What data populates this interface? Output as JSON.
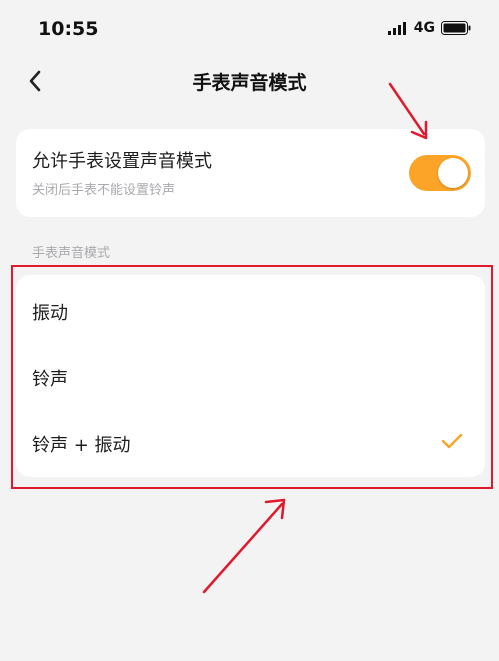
{
  "status_bar": {
    "time": "10:55",
    "network": "4G",
    "icons": [
      "signal-icon",
      "battery-icon"
    ]
  },
  "nav": {
    "back_icon": "chevron-left-icon",
    "title": "手表声音模式"
  },
  "permission": {
    "title": "允许手表设置声音模式",
    "subtitle": "关闭后手表不能设置铃声",
    "toggle_on": true,
    "toggle_color": "#fba428"
  },
  "section": {
    "label": "手表声音模式"
  },
  "options": [
    {
      "label": "振动",
      "selected": false
    },
    {
      "label": "铃声",
      "selected": false
    },
    {
      "label": "铃声 + 振动",
      "selected": true
    }
  ],
  "colors": {
    "accent": "#fba428",
    "annotation": "#e0192c",
    "background": "#f3f3f4"
  }
}
